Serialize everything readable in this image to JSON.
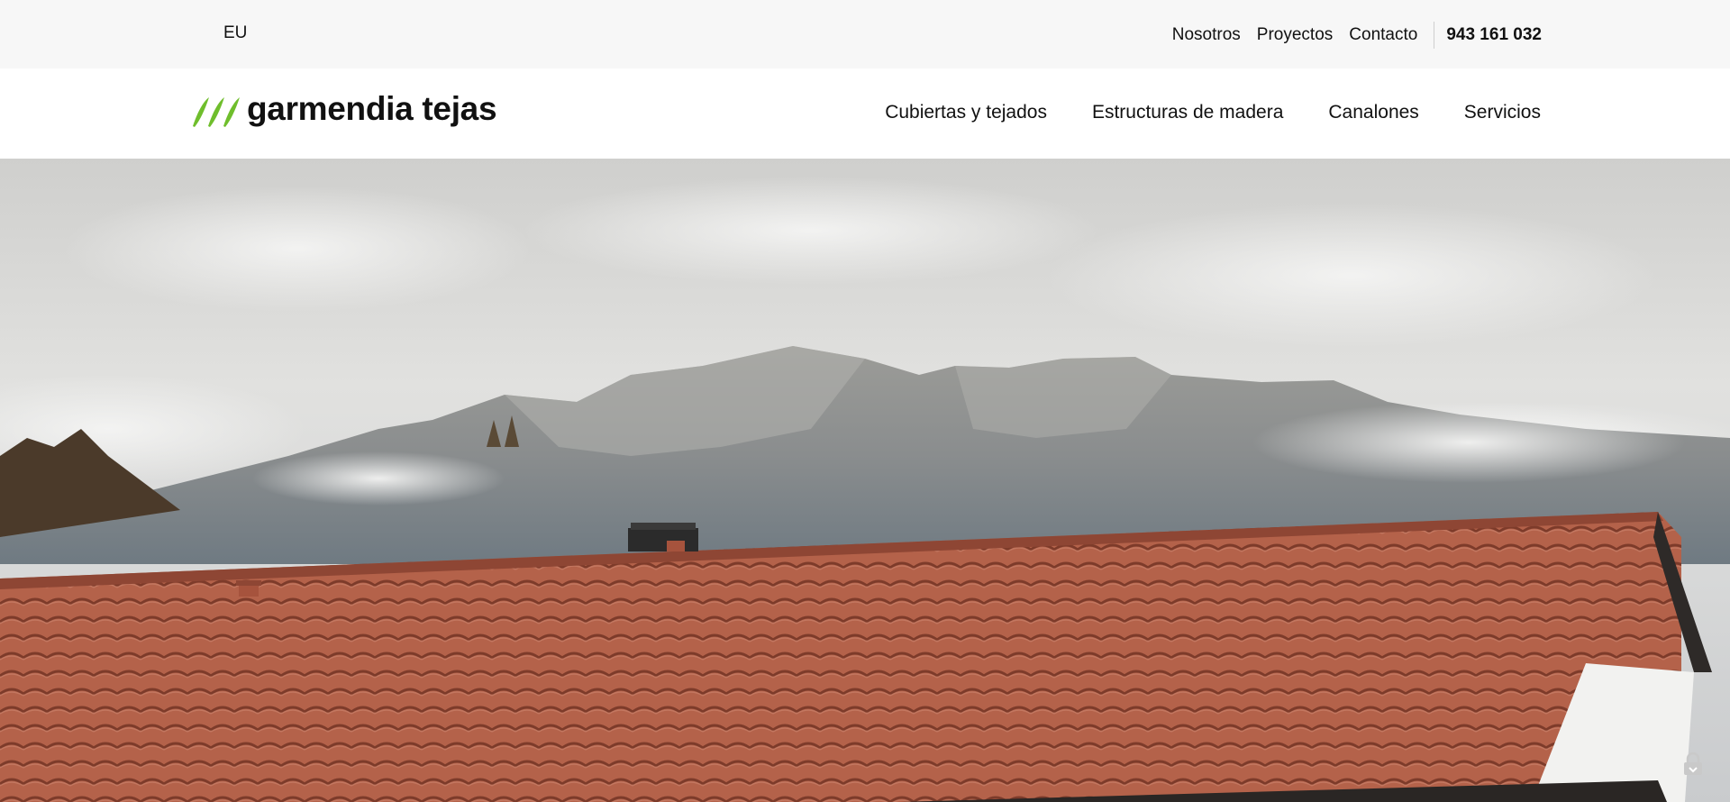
{
  "topbar": {
    "language": "EU",
    "links": [
      "Nosotros",
      "Proyectos",
      "Contacto"
    ],
    "phone": "943 161 032"
  },
  "header": {
    "logo_text": "garmendia tejas",
    "logo_color": "#6fbe2c",
    "nav": [
      "Cubiertas y tejados",
      "Estructuras de madera",
      "Canalones",
      "Servicios"
    ]
  },
  "hero": {
    "image": "tiled-roof-mountains-photo",
    "roof_color": "#b5624a",
    "sky_color": "#d8d8d6"
  },
  "widgets": {
    "icon": "lock-icon"
  }
}
